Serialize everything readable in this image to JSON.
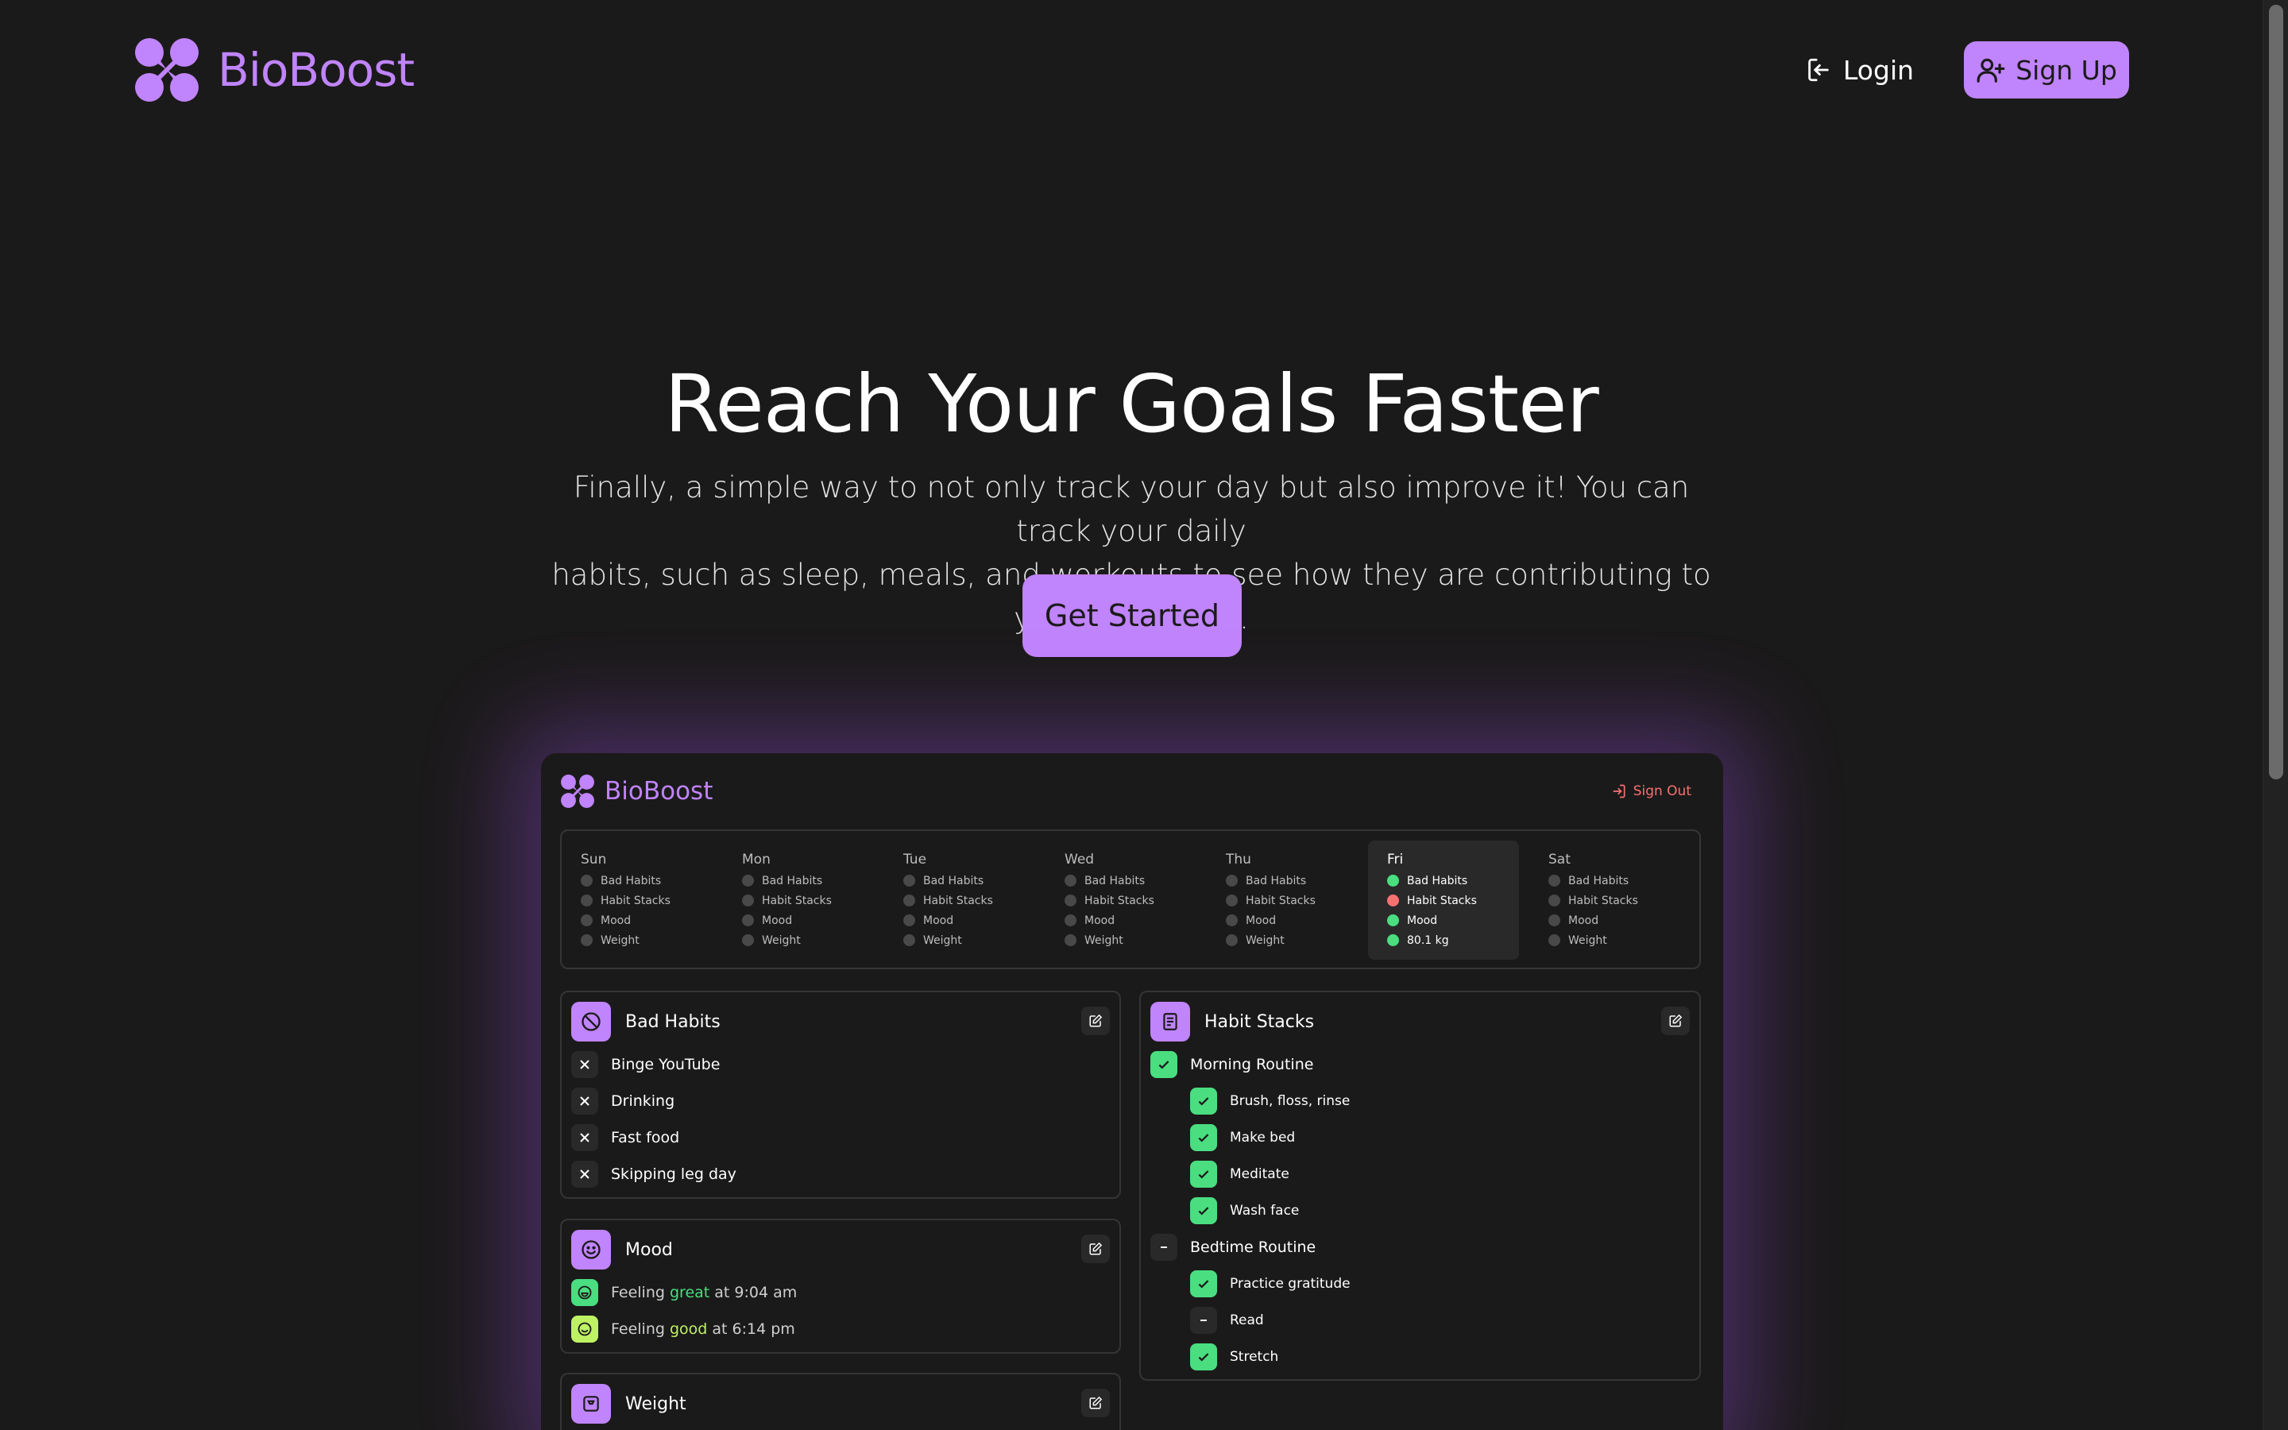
{
  "nav": {
    "brand": "BioBoost",
    "login_label": "Login",
    "signup_label": "Sign Up"
  },
  "hero": {
    "title": "Reach Your Goals Faster",
    "subtitle_line1": "Finally, a simple way to not only track your day but also improve it! You can track your daily",
    "subtitle_line2": "habits, such as sleep, meals, and workouts to see how they are contributing to your well-being.",
    "cta_label": "Get Started"
  },
  "preview": {
    "brand": "BioBoost",
    "signout_label": "Sign Out",
    "days": [
      {
        "name": "Sun",
        "rows": [
          "Bad Habits",
          "Habit Stacks",
          "Mood",
          "Weight"
        ],
        "status": [
          "none",
          "none",
          "none",
          "none"
        ]
      },
      {
        "name": "Mon",
        "rows": [
          "Bad Habits",
          "Habit Stacks",
          "Mood",
          "Weight"
        ],
        "status": [
          "none",
          "none",
          "none",
          "none"
        ]
      },
      {
        "name": "Tue",
        "rows": [
          "Bad Habits",
          "Habit Stacks",
          "Mood",
          "Weight"
        ],
        "status": [
          "none",
          "none",
          "none",
          "none"
        ]
      },
      {
        "name": "Wed",
        "rows": [
          "Bad Habits",
          "Habit Stacks",
          "Mood",
          "Weight"
        ],
        "status": [
          "none",
          "none",
          "none",
          "none"
        ]
      },
      {
        "name": "Thu",
        "rows": [
          "Bad Habits",
          "Habit Stacks",
          "Mood",
          "Weight"
        ],
        "status": [
          "none",
          "none",
          "none",
          "none"
        ]
      },
      {
        "name": "Fri",
        "rows": [
          "Bad Habits",
          "Habit Stacks",
          "Mood",
          "80.1 kg"
        ],
        "status": [
          "green",
          "red",
          "green",
          "green"
        ],
        "active": true
      },
      {
        "name": "Sat",
        "rows": [
          "Bad Habits",
          "Habit Stacks",
          "Mood",
          "Weight"
        ],
        "status": [
          "none",
          "none",
          "none",
          "none"
        ]
      }
    ],
    "bad_habits": {
      "title": "Bad Habits",
      "items": [
        "Binge YouTube",
        "Drinking",
        "Fast food",
        "Skipping leg day"
      ]
    },
    "mood": {
      "title": "Mood",
      "entries": [
        {
          "prefix": "Feeling",
          "level": "great",
          "suffix": "at 9:04 am"
        },
        {
          "prefix": "Feeling",
          "level": "good",
          "suffix": "at 6:14 pm"
        }
      ]
    },
    "weight": {
      "title": "Weight"
    },
    "habit_stacks": {
      "title": "Habit Stacks",
      "stacks": [
        {
          "name": "Morning Routine",
          "state": "done",
          "items": [
            {
              "label": "Brush, floss, rinse",
              "state": "done"
            },
            {
              "label": "Make bed",
              "state": "done"
            },
            {
              "label": "Meditate",
              "state": "done"
            },
            {
              "label": "Wash face",
              "state": "done"
            }
          ]
        },
        {
          "name": "Bedtime Routine",
          "state": "partial",
          "items": [
            {
              "label": "Practice gratitude",
              "state": "done"
            },
            {
              "label": "Read",
              "state": "skipped"
            },
            {
              "label": "Stretch",
              "state": "done"
            }
          ]
        }
      ]
    }
  },
  "colors": {
    "accent": "#c084fc",
    "background": "#1b1a1a",
    "success": "#4ade80",
    "danger": "#f87171",
    "good": "#bef264"
  },
  "icons": {
    "logo": "four-circle-molecule-icon",
    "login": "login-arrow-icon",
    "signup": "user-plus-icon",
    "signout": "logout-icon",
    "bad_habits": "no-sign-icon",
    "habit_stacks": "list-icon",
    "mood": "smile-icon",
    "weight": "scale-icon",
    "edit": "edit-icon"
  }
}
